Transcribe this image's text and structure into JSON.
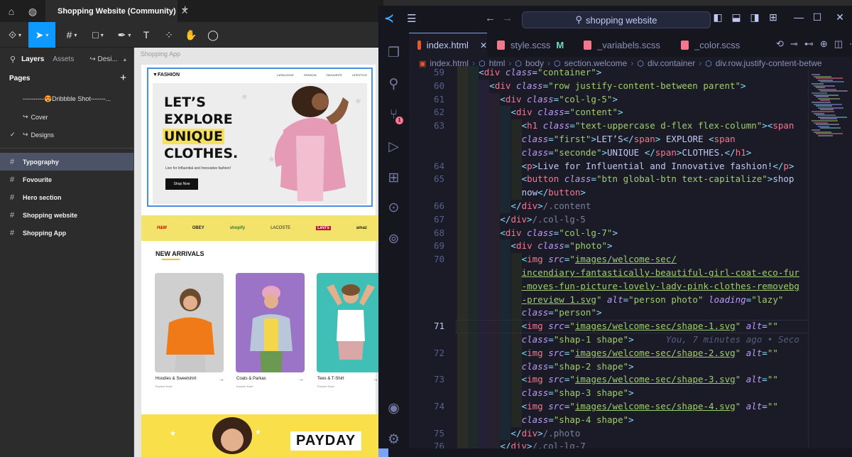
{
  "figma": {
    "tab_title": "Shopping Website (Community)",
    "tabs_icons": [
      "home-icon",
      "globe-icon",
      "close-icon",
      "plus-icon"
    ],
    "left_panel": {
      "tab_layers": "Layers",
      "tab_assets": "Assets",
      "tab_design": "Desi...",
      "pages_title": "Pages",
      "pages": [
        "----------😍Dribbble Shot-------...",
        "Cover",
        "Designs"
      ],
      "layers": [
        "Typography",
        "Fovourite",
        "Hero section",
        "Shopping website",
        "Shopping App"
      ]
    },
    "canvas": {
      "frame_label": "Shopping App",
      "hero": {
        "logo": "FASHION",
        "nav": [
          "CATALOGUE",
          "FASHION",
          "FAVOURITE",
          "LIFESTYLE"
        ],
        "headline": [
          "LET’S",
          "EXPLORE",
          "UNIQUE",
          "CLOTHES."
        ],
        "sub": "Live for Influential and Innovative fashion!",
        "button": "Shop Now"
      },
      "brands": [
        "H&M",
        "OBEY",
        "shopify",
        "LACOSTE",
        "Levi's",
        "amaz"
      ],
      "new_arrivals": "NEW ARRIVALS",
      "cards": [
        {
          "name": "Hoodies & Sweetshirt",
          "sub": "Explore Now!"
        },
        {
          "name": "Coats & Parkas",
          "sub": "Explore Now!"
        },
        {
          "name": "Tees & T-Shirt",
          "sub": "Explore Now!"
        }
      ],
      "payday": "PAYDAY"
    }
  },
  "vscode": {
    "search": "shopping website",
    "tabs": [
      {
        "label": "index.html",
        "mod": "",
        "color": "#e8572c"
      },
      {
        "label": "style.scss",
        "mod": "M",
        "color": "#f7768e"
      },
      {
        "label": "_variabels.scss",
        "mod": "",
        "color": "#f7768e"
      },
      {
        "label": "_color.scss",
        "mod": "",
        "color": "#f7768e"
      }
    ],
    "breadcrumb": [
      "index.html",
      "html",
      "body",
      "section.welcome",
      "div.container",
      "div.row.justify-content-betwe"
    ],
    "blame": "You, 7 minutes ago • Seco",
    "line_numbers": [
      "59",
      "60",
      "61",
      "62",
      "63",
      "",
      "",
      "64",
      "65",
      "",
      "66",
      "67",
      "68",
      "69",
      "70",
      "",
      "",
      "",
      "",
      "71",
      "",
      "72",
      "",
      "73",
      "",
      "74",
      "",
      "75",
      "76"
    ],
    "current_line": "71",
    "code_lines": [
      {
        "d": 2,
        "t": "ct-frag"
      },
      {
        "d": 3,
        "t": "row"
      },
      {
        "d": 4,
        "t": "col5"
      },
      {
        "d": 5,
        "t": "content"
      },
      {
        "d": 6,
        "t": "h1a"
      },
      {
        "d": 6,
        "t": "h1b"
      },
      {
        "d": 6,
        "t": "h1c"
      },
      {
        "d": 6,
        "t": "p"
      },
      {
        "d": 6,
        "t": "btn"
      },
      {
        "d": 6,
        "t": "btn2"
      },
      {
        "d": 5,
        "t": "enddiv-content"
      },
      {
        "d": 4,
        "t": "enddiv-col5"
      },
      {
        "d": 4,
        "t": "col7"
      },
      {
        "d": 5,
        "t": "photo"
      },
      {
        "d": 6,
        "t": "img1"
      }
    ]
  }
}
